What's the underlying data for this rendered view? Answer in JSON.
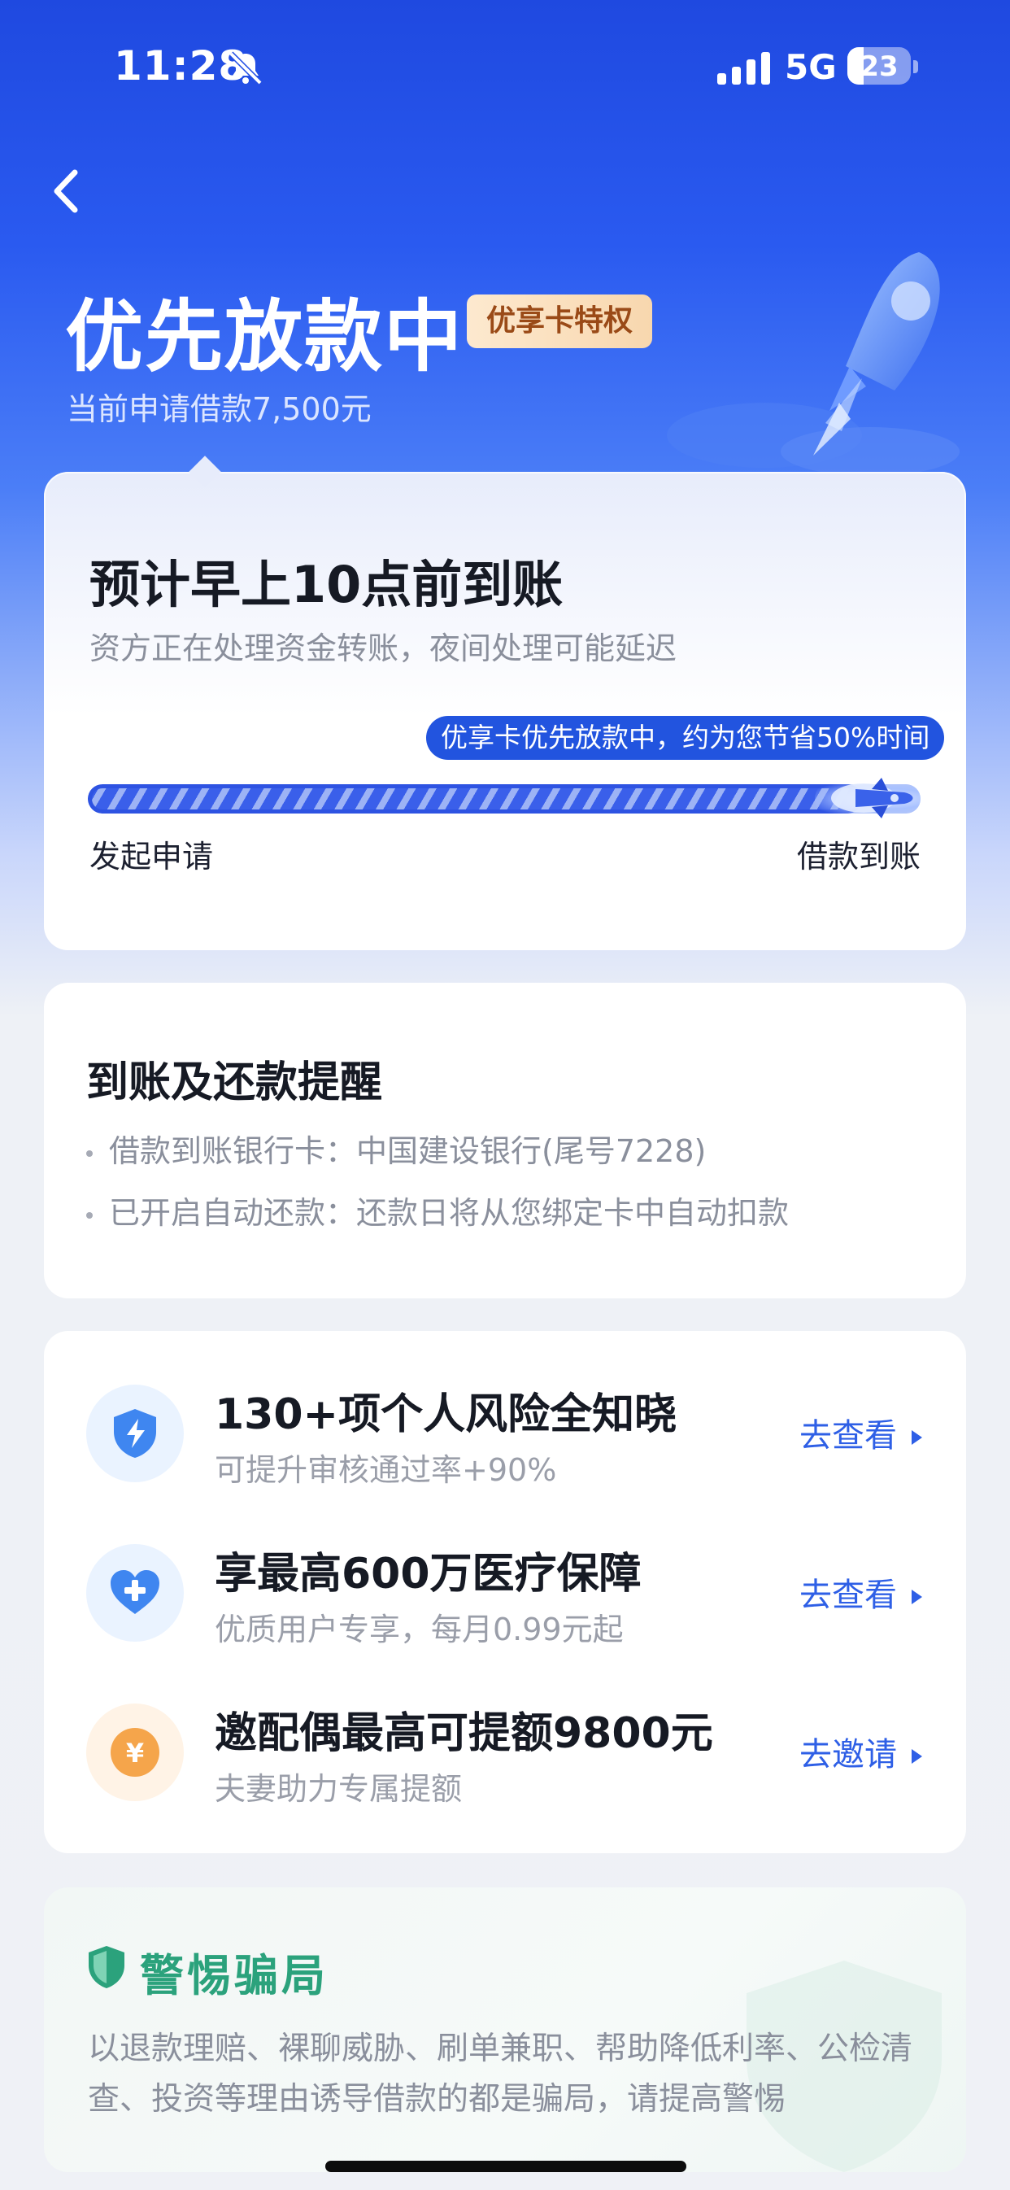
{
  "status_bar": {
    "time": "11:28",
    "network": "5G",
    "battery": "23"
  },
  "header": {
    "title": "优先放款中",
    "badge": "优享卡特权",
    "subtitle": "当前申请借款7,500元"
  },
  "progress_card": {
    "eta": "预计早上10点前到账",
    "description": "资方正在处理资金转账，夜间处理可能延迟",
    "tooltip": "优享卡优先放款中，约为您节省50%时间",
    "progress": 0.93,
    "step_start": "发起申请",
    "step_end": "借款到账"
  },
  "reminder": {
    "title": "到账及还款提醒",
    "items": [
      "借款到账银行卡：中国建设银行(尾号7228)",
      "已开启自动还款：还款日将从您绑定卡中自动扣款"
    ]
  },
  "promos": [
    {
      "icon": "shield-lightning-icon",
      "title": "130+项个人风险全知晓",
      "subtitle": "可提升审核通过率+90%",
      "action": "去查看",
      "color": "#3f86f0"
    },
    {
      "icon": "heart-plus-icon",
      "title": "享最高600万医疗保障",
      "subtitle": "优质用户专享，每月0.99元起",
      "action": "去查看",
      "color": "#3f86f0"
    },
    {
      "icon": "yuan-coin-icon",
      "title": "邀配偶最高可提额9800元",
      "subtitle": "夫妻助力专属提额",
      "action": "去邀请",
      "color": "#f5a54b"
    }
  ],
  "warning": {
    "title": "警惕骗局",
    "text": "以退款理赔、裸聊威胁、刷单兼职、帮助降低利率、公检清查、投资等理由诱导借款的都是骗局，请提高警惕"
  },
  "colors": {
    "brand_blue": "#2254df",
    "link_blue": "#2e5fe6",
    "warning_green": "#2ba27c"
  }
}
